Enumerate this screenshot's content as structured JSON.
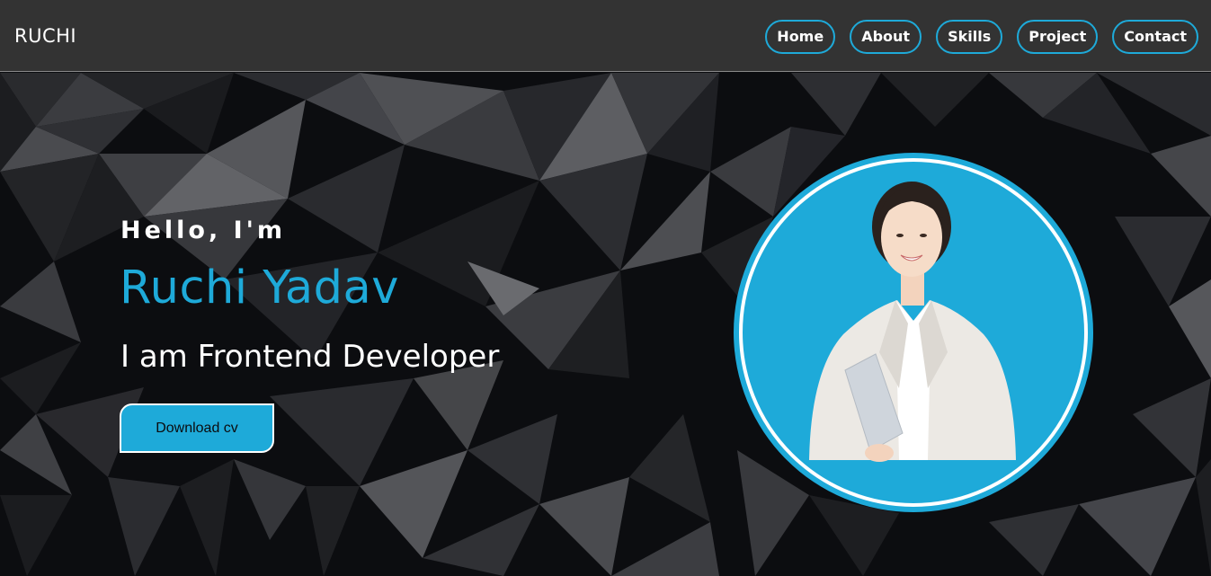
{
  "navbar": {
    "brand": "RUCHI",
    "links": [
      "Home",
      "About",
      "Skills",
      "Project",
      "Contact"
    ],
    "accent": "#1eaad9",
    "background": "#333333"
  },
  "hero": {
    "greeting": "Hello, I'm",
    "name": "Ruchi Yadav",
    "role": "I am Frontend Developer",
    "cv_button": "Download cv",
    "avatar_icon": "profile-photo"
  }
}
